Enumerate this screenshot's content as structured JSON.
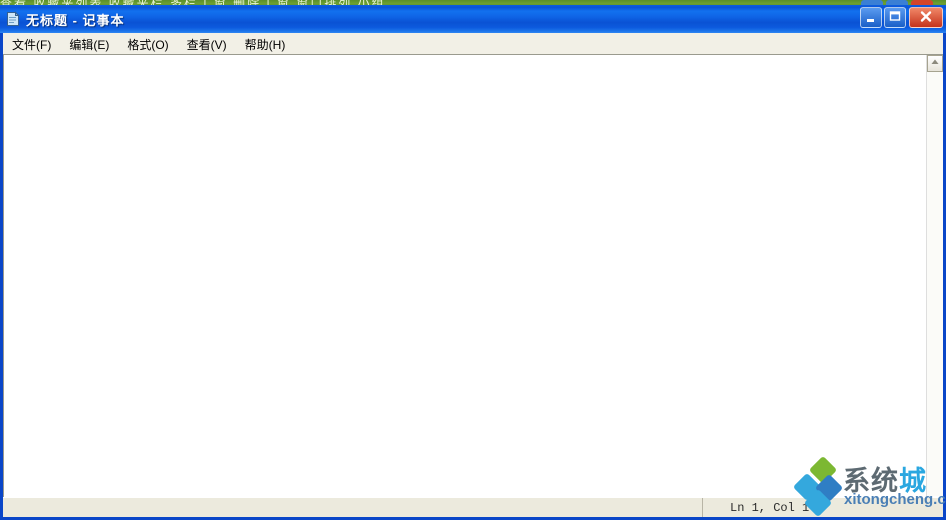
{
  "background_window": {
    "visible_fragment_text": "查看    收藏夹列表    收藏夹栏    多栏 | 窗    删除 | 窗    窗口排列    小组",
    "buttons": [
      "minimize",
      "maximize",
      "close"
    ]
  },
  "window": {
    "title": "无标题 - 记事本",
    "icon": "notepad-document-icon",
    "controls": {
      "minimize_label": "最小化",
      "maximize_label": "最大化",
      "close_label": "关闭"
    }
  },
  "menubar": {
    "items": [
      {
        "label": "文件(F)",
        "name": "menu-file"
      },
      {
        "label": "编辑(E)",
        "name": "menu-edit"
      },
      {
        "label": "格式(O)",
        "name": "menu-format"
      },
      {
        "label": "查看(V)",
        "name": "menu-view"
      },
      {
        "label": "帮助(H)",
        "name": "menu-help"
      }
    ]
  },
  "editor": {
    "content": "",
    "placeholder": ""
  },
  "scrollbar": {
    "up_arrow": "scroll-up-icon"
  },
  "statusbar": {
    "left_pane": "",
    "position_text": "Ln 1, Col 1"
  },
  "watermark": {
    "brand_cn_part1": "系统",
    "brand_cn_part2": "城",
    "brand_url": "xitongcheng.com",
    "logo": "diamond-cluster-logo"
  },
  "colors": {
    "titlebar_blue": "#0f64e6",
    "window_border_blue": "#0a46c8",
    "close_button_red": "#c5331c",
    "menubar_bg": "#f2f0e6",
    "statusbar_bg": "#eceadd",
    "background_strip_green": "#6ea033",
    "watermark_green": "#7cb832",
    "watermark_blue": "#34a8dd"
  }
}
